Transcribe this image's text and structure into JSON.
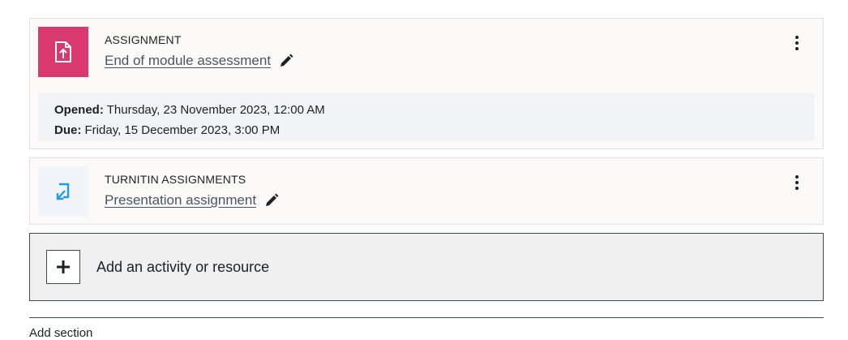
{
  "activities": [
    {
      "type_label": "ASSIGNMENT",
      "name": "End of module assessment",
      "icon": "assignment-upload-icon",
      "icon_bg": "#d9396f",
      "dates": {
        "opened_label": "Opened:",
        "opened_value": "Thursday, 23 November 2023, 12:00 AM",
        "due_label": "Due:",
        "due_value": "Friday, 15 December 2023, 3:00 PM"
      }
    },
    {
      "type_label": "TURNITIN ASSIGNMENTS",
      "name": "Presentation assignment",
      "icon": "turnitin-icon",
      "icon_bg": "#f1f4f8"
    }
  ],
  "add_activity": {
    "label": "Add an activity or resource",
    "icon": "plus-icon"
  },
  "footer": {
    "partial_text": "Add section"
  },
  "colors": {
    "accent": "#d9396f",
    "turnitin_blue": "#1e9be9",
    "border_dark": "#3d4a5c"
  }
}
